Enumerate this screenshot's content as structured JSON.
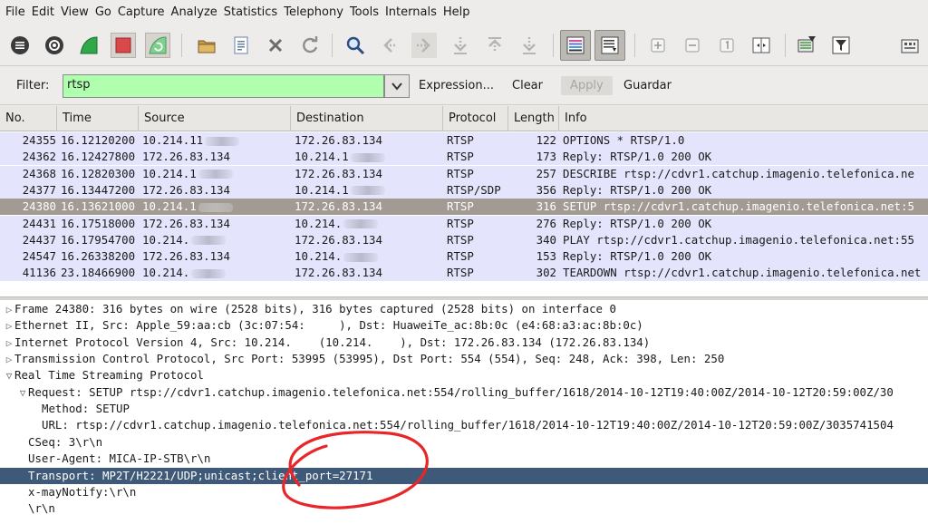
{
  "menubar": [
    "File",
    "Edit",
    "View",
    "Go",
    "Capture",
    "Analyze",
    "Statistics",
    "Telephony",
    "Tools",
    "Internals",
    "Help"
  ],
  "toolbar_icons": [
    "interfaces-icon",
    "options-icon",
    "start-capture-icon",
    "stop-capture-icon",
    "restart-capture-icon",
    "open-file-icon",
    "save-file-icon",
    "close-file-icon",
    "reload-icon",
    "find-packet-icon",
    "go-back-icon",
    "go-forward-icon",
    "go-to-packet-icon",
    "first-packet-icon",
    "last-packet-icon",
    "colorize-icon",
    "autoscroll-icon",
    "zoom-in-icon",
    "zoom-out-icon",
    "normal-size-icon",
    "resize-columns-icon",
    "capture-filters-icon",
    "display-filters-icon",
    "preferences-icon"
  ],
  "filter": {
    "label": "Filter:",
    "value": "rtsp",
    "expression": "Expression...",
    "clear": "Clear",
    "apply": "Apply",
    "save": "Guardar",
    "bg_color": "#afffaf"
  },
  "columns": [
    "No.",
    "Time",
    "Source",
    "Destination",
    "Protocol",
    "Length",
    "Info"
  ],
  "packets": [
    {
      "no": "24355",
      "time": "16.12120200",
      "src": "10.214.11",
      "dst": "172.26.83.134",
      "proto": "RTSP",
      "len": "122",
      "info": "OPTIONS * RTSP/1.0"
    },
    {
      "no": "24362",
      "time": "16.12427800",
      "src": "172.26.83.134",
      "dst": "10.214.1",
      "proto": "RTSP",
      "len": "173",
      "info": "Reply: RTSP/1.0 200 OK"
    },
    {
      "no": "24368",
      "time": "16.12820300",
      "src": "10.214.1",
      "dst": "172.26.83.134",
      "proto": "RTSP",
      "len": "257",
      "info": "DESCRIBE rtsp://cdvr1.catchup.imagenio.telefonica.ne"
    },
    {
      "no": "24377",
      "time": "16.13447200",
      "src": "172.26.83.134",
      "dst": "10.214.1",
      "proto": "RTSP/SDP",
      "len": "356",
      "info": "Reply: RTSP/1.0 200 OK"
    },
    {
      "no": "24380",
      "time": "16.13621000",
      "src": "10.214.1",
      "dst": "172.26.83.134",
      "proto": "RTSP",
      "len": "316",
      "info": "SETUP rtsp://cdvr1.catchup.imagenio.telefonica.net:5",
      "selected": true
    },
    {
      "no": "24431",
      "time": "16.17518000",
      "src": "172.26.83.134",
      "dst": "10.214.",
      "proto": "RTSP",
      "len": "276",
      "info": "Reply: RTSP/1.0 200 OK"
    },
    {
      "no": "24437",
      "time": "16.17954700",
      "src": "10.214.",
      "dst": "172.26.83.134",
      "proto": "RTSP",
      "len": "340",
      "info": "PLAY rtsp://cdvr1.catchup.imagenio.telefonica.net:55"
    },
    {
      "no": "24547",
      "time": "16.26338200",
      "src": "172.26.83.134",
      "dst": "10.214.",
      "proto": "RTSP",
      "len": "153",
      "info": "Reply: RTSP/1.0 200 OK"
    },
    {
      "no": "41136",
      "time": "23.18466900",
      "src": "10.214.",
      "dst": "172.26.83.134",
      "proto": "RTSP",
      "len": "302",
      "info": "TEARDOWN rtsp://cdvr1.catchup.imagenio.telefonica.net"
    }
  ],
  "details": [
    {
      "text": "Frame 24380: 316 bytes on wire (2528 bits), 316 bytes captured (2528 bits) on interface 0",
      "indent": 0,
      "toggle": "collapsed"
    },
    {
      "text": "Ethernet II, Src: Apple_59:aa:cb (3c:07:54:     ), Dst: HuaweiTe_ac:8b:0c (e4:68:a3:ac:8b:0c)",
      "indent": 0,
      "toggle": "collapsed"
    },
    {
      "text": "Internet Protocol Version 4, Src: 10.214.    (10.214.    ), Dst: 172.26.83.134 (172.26.83.134)",
      "indent": 0,
      "toggle": "collapsed"
    },
    {
      "text": "Transmission Control Protocol, Src Port: 53995 (53995), Dst Port: 554 (554), Seq: 248, Ack: 398, Len: 250",
      "indent": 0,
      "toggle": "collapsed"
    },
    {
      "text": "Real Time Streaming Protocol",
      "indent": 0,
      "toggle": "expanded"
    },
    {
      "text": "Request: SETUP rtsp://cdvr1.catchup.imagenio.telefonica.net:554/rolling_buffer/1618/2014-10-12T19:40:00Z/2014-10-12T20:59:00Z/30",
      "indent": 1,
      "toggle": "expanded"
    },
    {
      "text": "Method: SETUP",
      "indent": 2,
      "toggle": "none"
    },
    {
      "text": "URL: rtsp://cdvr1.catchup.imagenio.telefonica.net:554/rolling_buffer/1618/2014-10-12T19:40:00Z/2014-10-12T20:59:00Z/3035741504",
      "indent": 2,
      "toggle": "none"
    },
    {
      "text": "CSeq: 3\\r\\n",
      "indent": 1,
      "toggle": "none"
    },
    {
      "text": "User-Agent: MICA-IP-STB\\r\\n",
      "indent": 1,
      "toggle": "none"
    },
    {
      "text": "Transport: MP2T/H2221/UDP;unicast;client_port=27171",
      "indent": 1,
      "toggle": "none",
      "selected": true
    },
    {
      "text": "x-mayNotify:\\r\\n",
      "indent": 1,
      "toggle": "none"
    },
    {
      "text": "\\r\\n",
      "indent": 1,
      "toggle": "none"
    }
  ],
  "colors": {
    "row_bg": "#e4e4fc",
    "row_selected": "#a19b93",
    "detail_selected": "#3f5a78",
    "annotation": "#e8262a"
  }
}
